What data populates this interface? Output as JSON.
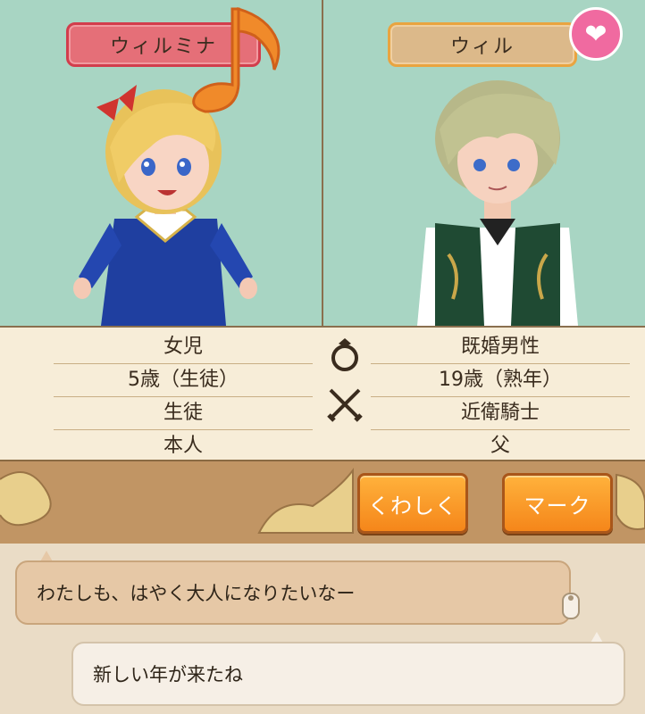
{
  "left_character": {
    "name": "ウィルミナ",
    "info": [
      "女児",
      "5歳（生徒）",
      "生徒",
      "本人"
    ]
  },
  "right_character": {
    "name": "ウィル",
    "info": [
      "既婚男性",
      "19歳（熟年）",
      "近衛騎士",
      "父"
    ]
  },
  "icons": {
    "music": "music-note-icon",
    "heart": "heart-icon",
    "ring": "ring-icon",
    "swords": "crossed-swords-icon",
    "tap": "tap-finger-icon"
  },
  "buttons": {
    "detail": "くわしく",
    "mark": "マーク"
  },
  "chat": {
    "message_1": "わたしも、はやく大人になりたいなー",
    "message_2": "新しい年が来たね"
  },
  "colors": {
    "panel_bg": "#a8d5c3",
    "name_red": "#e56f78",
    "name_tan": "#dcb98a",
    "heart": "#f06aa0",
    "button_orange": "#f5861a"
  }
}
